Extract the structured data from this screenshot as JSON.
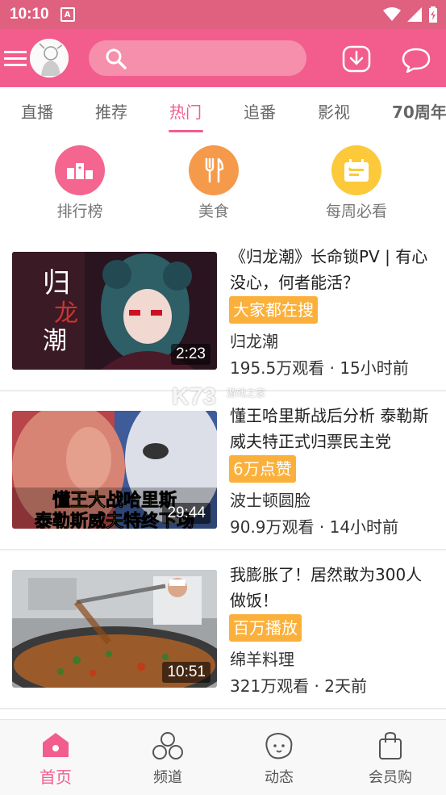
{
  "status": {
    "time": "10:10",
    "a_badge": "A"
  },
  "app": {
    "accent": "#f25d8e",
    "search_placeholder": ""
  },
  "tabs": [
    "直播",
    "推荐",
    "热门",
    "追番",
    "影视",
    "70周年"
  ],
  "active_tab": "热门",
  "quick": [
    {
      "label": "排行榜",
      "icon": "ranking-icon",
      "color": "#f4668f"
    },
    {
      "label": "美食",
      "icon": "fork-knife-icon",
      "color": "#f59a4b"
    },
    {
      "label": "每周必看",
      "icon": "calendar-icon",
      "color": "#fbc93a"
    }
  ],
  "videos": [
    {
      "title": "《归龙潮》长命锁PV | 有心没心，何者能活？",
      "tag": "大家都在搜",
      "author": "归龙潮",
      "stats": "195.5万观看 · 15小时前",
      "duration": "2:23",
      "thumb_text": "归龙潮"
    },
    {
      "title": "懂王哈里斯战后分析 泰勒斯威夫特正式归票民主党",
      "tag": "6万点赞",
      "author": "波士顿圆脸",
      "stats": "90.9万观看 · 14小时前",
      "duration": "29:44",
      "thumb_text": "懂王大战哈里斯 泰勒斯威夫特终下场"
    },
    {
      "title": "我膨胀了！居然敢为300人做饭！",
      "tag": "百万播放",
      "author": "绵羊料理",
      "stats": "321万观看 · 2天前",
      "duration": "10:51",
      "thumb_text": ""
    }
  ],
  "bottom_nav": [
    {
      "label": "首页",
      "icon": "home-icon",
      "active": true
    },
    {
      "label": "频道",
      "icon": "channels-icon",
      "active": false
    },
    {
      "label": "动态",
      "icon": "moments-icon",
      "active": false
    },
    {
      "label": "会员购",
      "icon": "shopping-bag-icon",
      "active": false
    }
  ],
  "watermark": {
    "main": "K73",
    "sub": "游戏之家"
  }
}
